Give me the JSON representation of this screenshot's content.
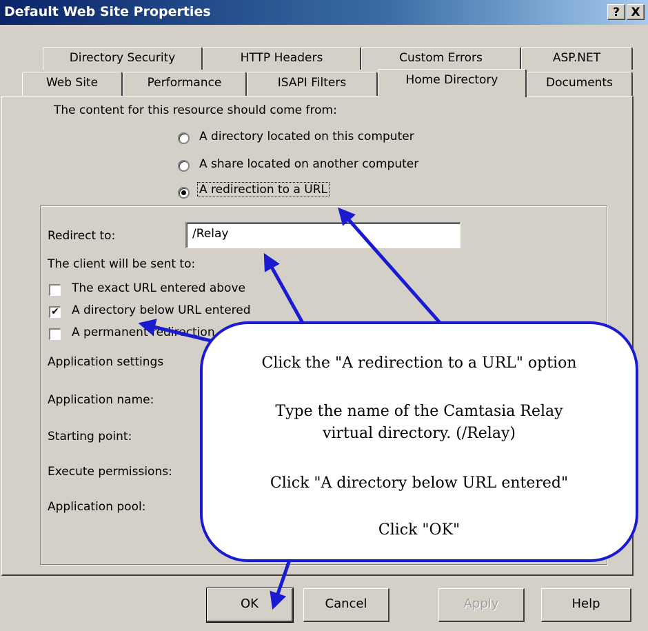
{
  "window": {
    "title": "Default Web Site Properties",
    "help_button": "?",
    "close_button": "X"
  },
  "tabs_row1": [
    "Directory Security",
    "HTTP Headers",
    "Custom Errors",
    "ASP.NET"
  ],
  "tabs_row2": [
    "Web Site",
    "Performance",
    "ISAPI Filters",
    "Home Directory",
    "Documents"
  ],
  "active_tab": "Home Directory",
  "content": {
    "source_prompt": "The content for this resource should come from:",
    "options": [
      {
        "label": "A directory located on this computer",
        "selected": false
      },
      {
        "label": "A share located on another computer",
        "selected": false
      },
      {
        "label": "A redirection to a URL",
        "selected": true
      }
    ],
    "redirect_label": "Redirect to:",
    "redirect_value": "/Relay",
    "client_sent_label": "The client will be sent to:",
    "checkboxes": [
      {
        "label": "The exact URL entered above",
        "checked": false
      },
      {
        "label": "A directory below URL entered",
        "checked": true
      },
      {
        "label": "A permanent redirection",
        "checked": false
      }
    ],
    "app_settings_label": "Application settings",
    "app_name_label": "Application name:",
    "starting_point_label": "Starting point:",
    "execute_permissions_label": "Execute permissions:",
    "app_pool_label": "Application pool:"
  },
  "callout": {
    "line1": "Click the \"A redirection to a URL\" option",
    "line2": "Type the name of the Camtasia Relay",
    "line3": "virtual directory.  (/Relay)",
    "line4": "Click \"A directory below URL entered\"",
    "line5": "Click \"OK\""
  },
  "buttons": {
    "ok": "OK",
    "cancel": "Cancel",
    "apply": "Apply",
    "help": "Help"
  },
  "colors": {
    "titlebar": "#0a246a",
    "dialog": "#d4d0c8",
    "callout_border": "#1a1ad0"
  }
}
